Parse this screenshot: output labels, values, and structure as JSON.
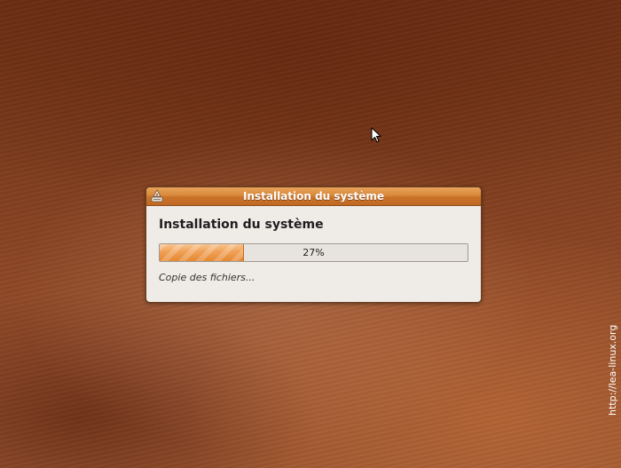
{
  "dialog": {
    "window_title": "Installation du système",
    "heading": "Installation du système",
    "progress": {
      "percent": 27,
      "label": "27%"
    },
    "status_text": "Copie des fichiers..."
  },
  "watermark": "http://lea-linux.org",
  "icons": {
    "title_icon": "installer-icon",
    "cursor": "mouse-pointer-icon"
  },
  "colors": {
    "titlebar": "#d9883a",
    "progress_fill": "#f0a055",
    "dialog_bg": "#efebe7",
    "desktop_bg": "#7a3a1b"
  }
}
